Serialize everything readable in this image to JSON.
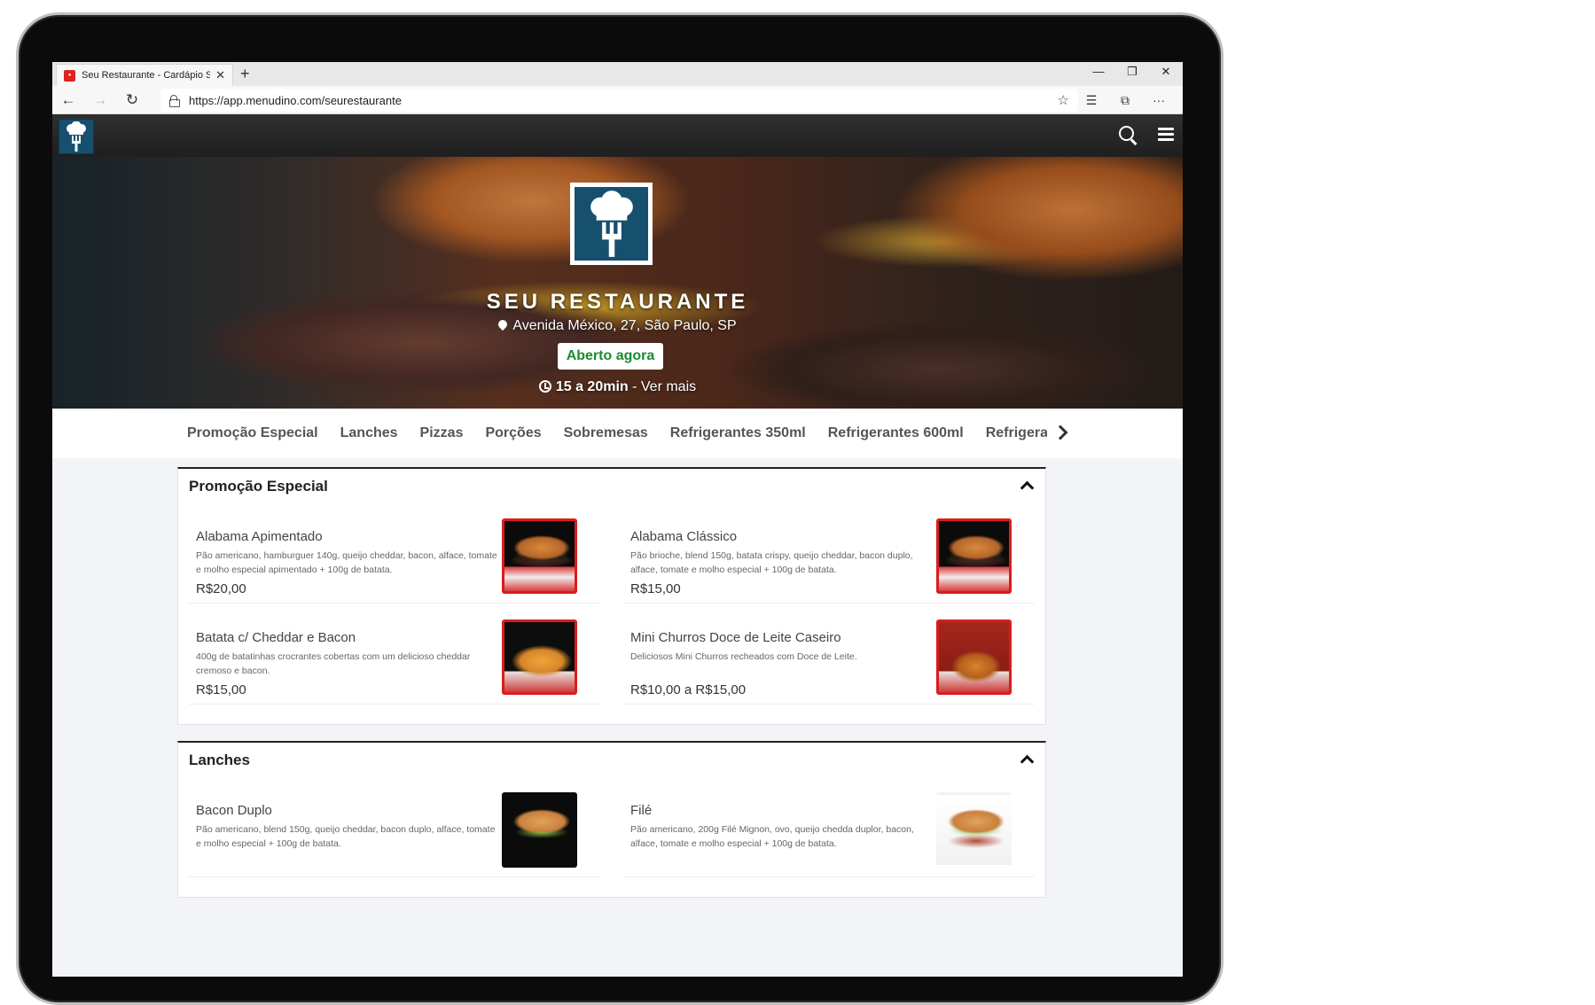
{
  "browser": {
    "tab_title": "Seu Restaurante - Cardápio Si",
    "url": "https://app.menudino.com/seurestaurante"
  },
  "hero": {
    "name": "SEU RESTAURANTE",
    "address": "Avenida México, 27, São Paulo, SP",
    "status": "Aberto agora",
    "time": "15 a 20min",
    "time_more": " - Ver mais"
  },
  "categories": [
    "Promoção Especial",
    "Lanches",
    "Pizzas",
    "Porções",
    "Sobremesas",
    "Refrigerantes 350ml",
    "Refrigerantes 600ml",
    "Refrigerant"
  ],
  "sections": [
    {
      "title": "Promoção Especial",
      "items": [
        {
          "name": "Alabama Apimentado",
          "desc": "Pão americano, hamburguer 140g, queijo cheddar, bacon, alface, tomate e molho especial apimentado + 100g de batata.",
          "price": "R$20,00"
        },
        {
          "name": "Alabama Clássico",
          "desc": "Pão brioche, blend 150g, batata crispy, queijo cheddar, bacon duplo, alface, tomate e molho especial + 100g de batata.",
          "price": "R$15,00"
        },
        {
          "name": "Batata c/ Cheddar e Bacon",
          "desc": "400g de batatinhas crocrantes cobertas com um delicioso cheddar cremoso e bacon.",
          "price": "R$15,00"
        },
        {
          "name": "Mini Churros Doce de Leite Caseiro",
          "desc": "Deliciosos Mini Churros recheados com Doce de Leite.",
          "price": "R$10,00 a R$15,00"
        }
      ]
    },
    {
      "title": "Lanches",
      "items": [
        {
          "name": "Bacon Duplo",
          "desc": "Pão americano, blend 150g, queijo cheddar, bacon duplo, alface, tomate e molho especial + 100g de batata.",
          "price": ""
        },
        {
          "name": "Filé",
          "desc": "Pão americano, 200g Filé Mignon, ovo, queijo chedda duplor, bacon, alface, tomate e molho especial + 100g de batata.",
          "price": ""
        }
      ]
    }
  ]
}
